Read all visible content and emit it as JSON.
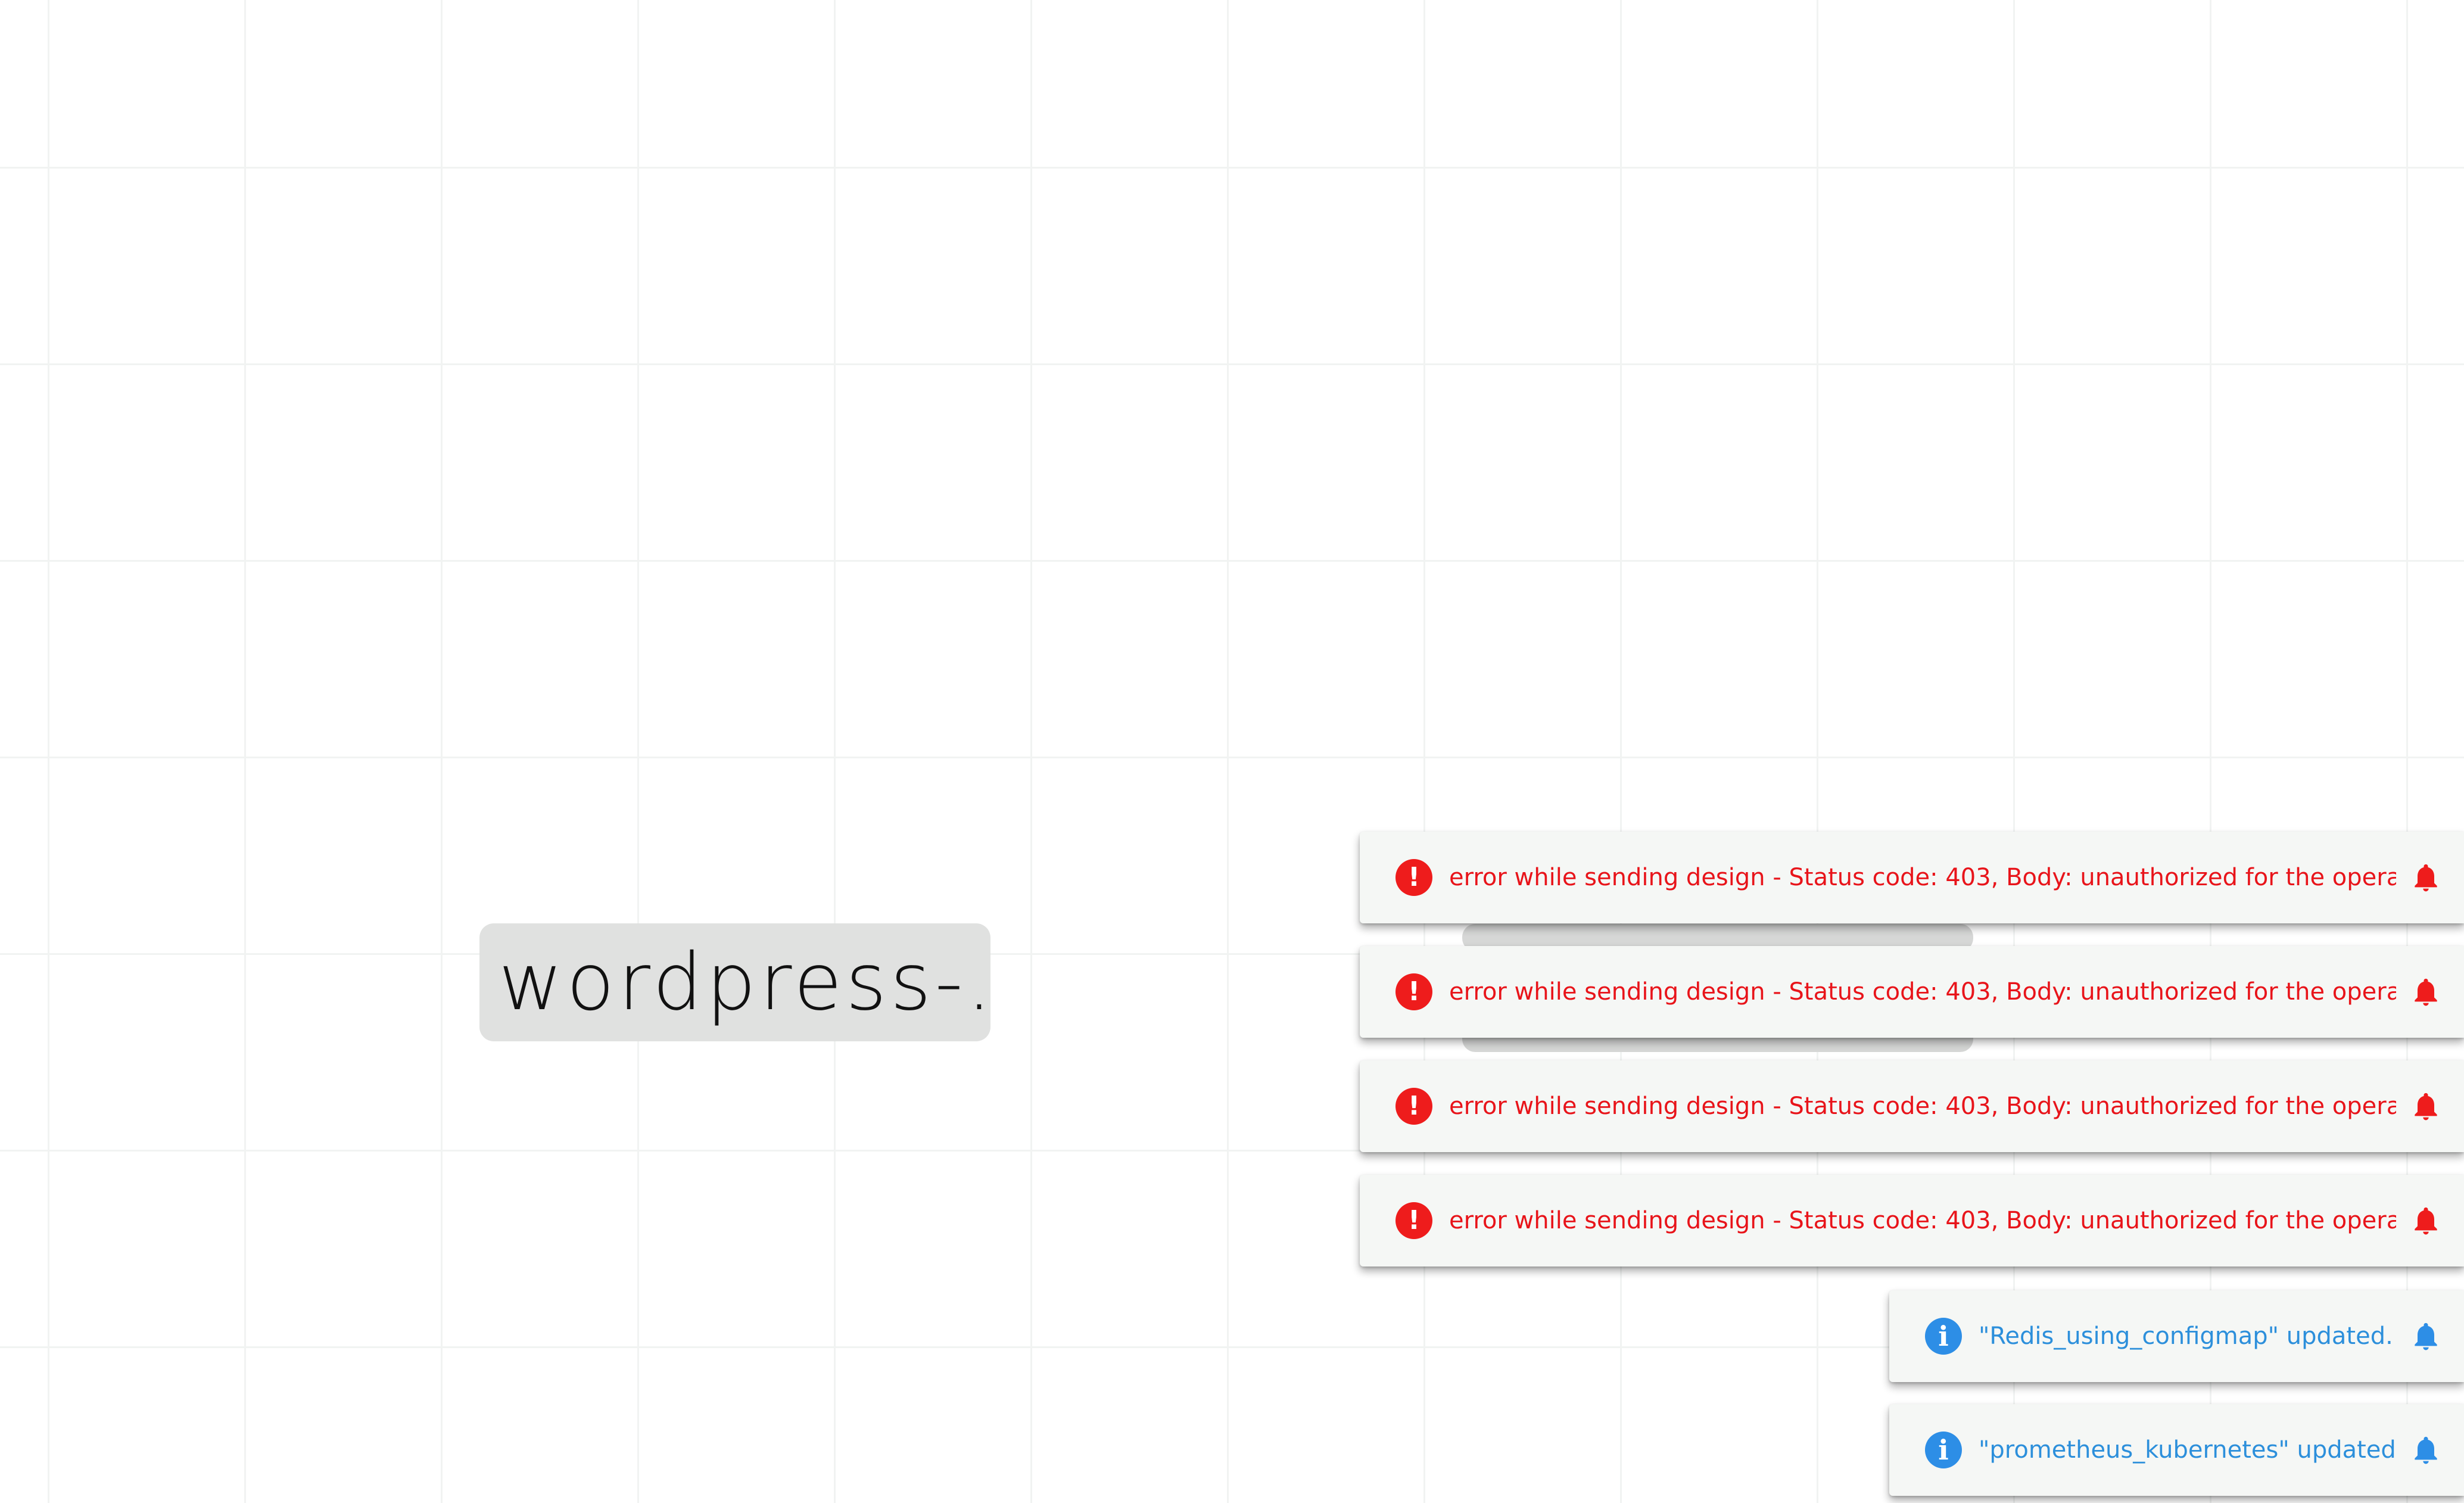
{
  "canvas": {
    "node": {
      "label": "wordpress-..."
    }
  },
  "notifications": [
    {
      "type": "error",
      "status_icon": "error-exclamation-icon",
      "message": "error while sending design - Status code: 403, Body: unauthorized for the operation",
      "action_icon": "bell-icon"
    },
    {
      "type": "error",
      "status_icon": "error-exclamation-icon",
      "message": "error while sending design - Status code: 403, Body: unauthorized for the operation",
      "action_icon": "bell-icon"
    },
    {
      "type": "error",
      "status_icon": "error-exclamation-icon",
      "message": "error while sending design - Status code: 403, Body: unauthorized for the operation",
      "action_icon": "bell-icon"
    },
    {
      "type": "error",
      "status_icon": "error-exclamation-icon",
      "message": "error while sending design - Status code: 403, Body: unauthorized for the operation",
      "action_icon": "bell-icon"
    },
    {
      "type": "info",
      "status_icon": "info-icon",
      "message": "\"Redis_using_configmap\" updated.",
      "action_icon": "bell-icon"
    },
    {
      "type": "info",
      "status_icon": "info-icon",
      "message": "\"prometheus_kubernetes\" updated.",
      "action_icon": "bell-icon"
    }
  ],
  "colors": {
    "error": "#ee1c1c",
    "info": "#2d8ee6",
    "toast_background": "#f5f7f5",
    "node_background": "#e0e1e0",
    "grid_line": "#f1f3f2"
  }
}
